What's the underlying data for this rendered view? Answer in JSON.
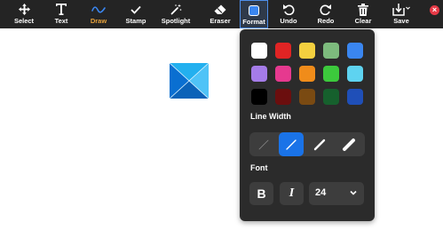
{
  "toolbar": {
    "tools": [
      {
        "id": "select",
        "label": "Select"
      },
      {
        "id": "text",
        "label": "Text"
      },
      {
        "id": "draw",
        "label": "Draw"
      },
      {
        "id": "stamp",
        "label": "Stamp"
      },
      {
        "id": "spotlight",
        "label": "Spotlight"
      },
      {
        "id": "eraser",
        "label": "Eraser"
      },
      {
        "id": "format",
        "label": "Format"
      },
      {
        "id": "undo",
        "label": "Undo"
      },
      {
        "id": "redo",
        "label": "Redo"
      },
      {
        "id": "clear",
        "label": "Clear"
      },
      {
        "id": "save",
        "label": "Save"
      }
    ],
    "active_tool": "draw",
    "open_tool": "format",
    "active_color": "#e8a33c",
    "close_icon": "close-icon"
  },
  "canvas": {
    "shape": {
      "icon": "windows-logo-icon",
      "colors": [
        "#1aa3e8",
        "#0a6fd1",
        "#4fc3f7",
        "#0b62b8"
      ]
    }
  },
  "format_panel": {
    "colors": [
      "#ffffff",
      "#e02424",
      "#f4d03f",
      "#7dbb7d",
      "#3a86f0",
      "#a57ce8",
      "#e6398f",
      "#f08c1a",
      "#3cc93c",
      "#5ed3f0",
      "#000000",
      "#6b0e0e",
      "#7a4a12",
      "#16602d",
      "#1f4fb8"
    ],
    "line_width_label": "Line Width",
    "line_widths": [
      {
        "name": "thinnest",
        "selected": false
      },
      {
        "name": "thin",
        "selected": true
      },
      {
        "name": "medium",
        "selected": false
      },
      {
        "name": "thick",
        "selected": false
      }
    ],
    "font_label": "Font",
    "bold_label": "B",
    "italic_label": "I",
    "font_size": "24"
  }
}
